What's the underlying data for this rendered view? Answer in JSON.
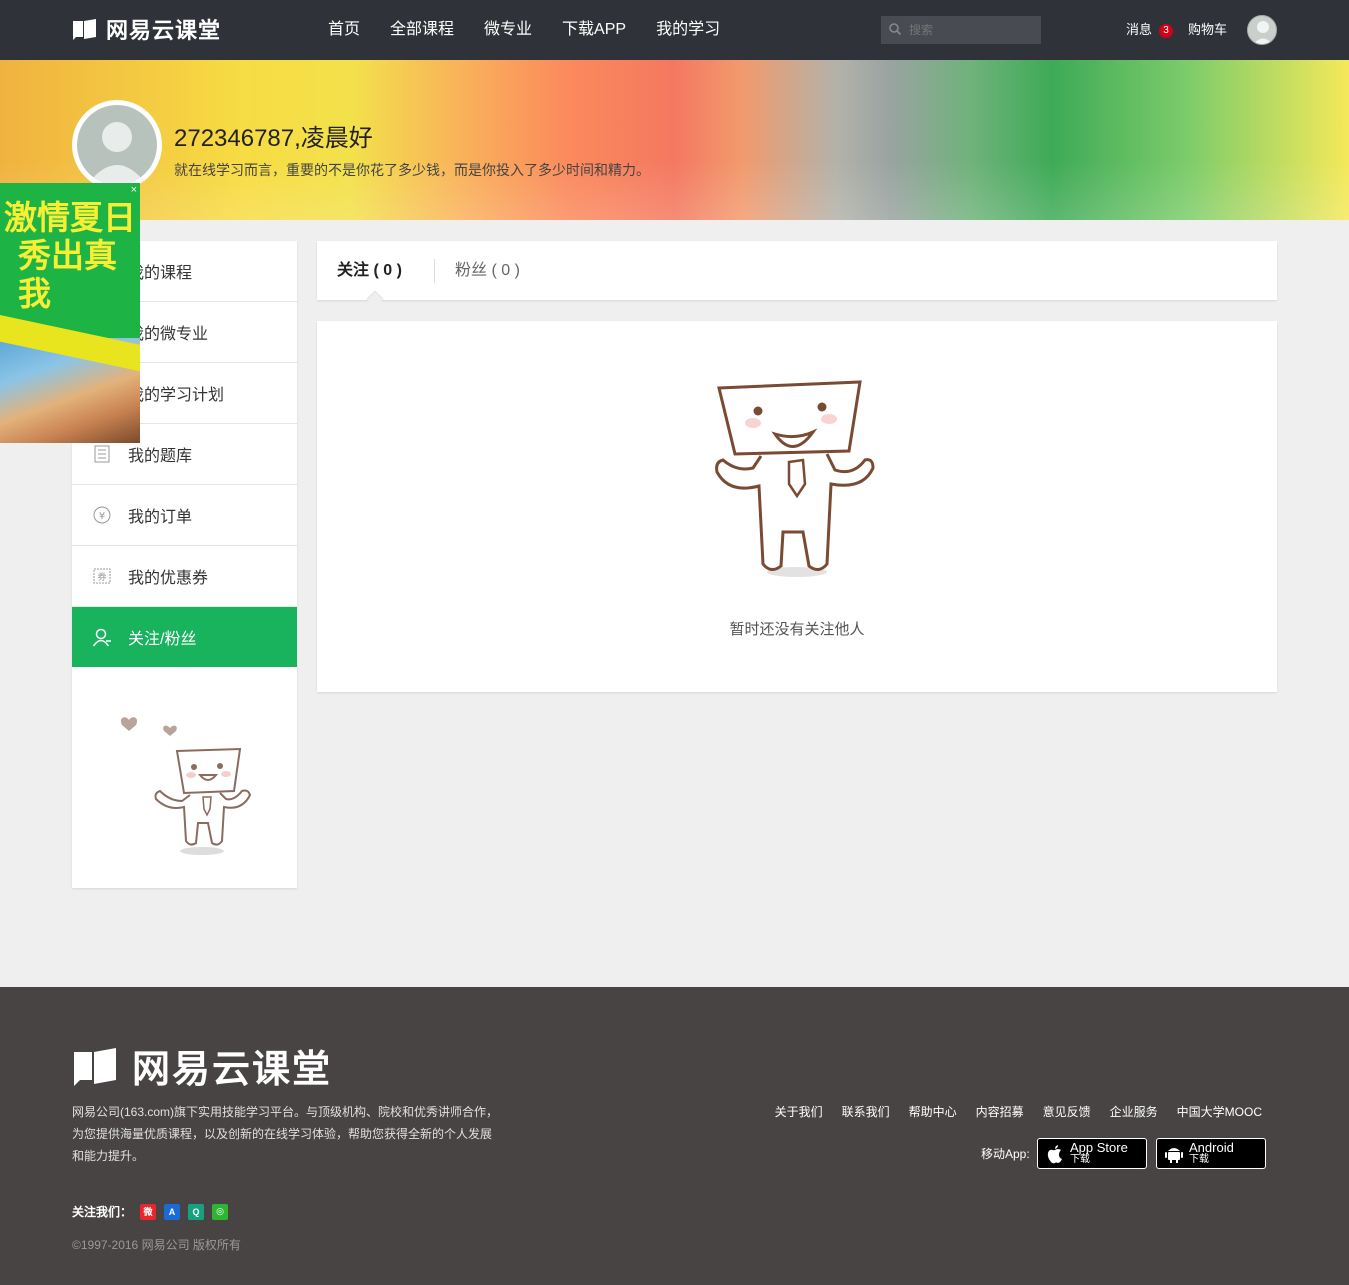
{
  "header": {
    "logo_text": "网易云课堂",
    "nav": [
      "首页",
      "全部课程",
      "微专业",
      "下载APP",
      "我的学习"
    ],
    "search_placeholder": "搜索",
    "messages_label": "消息",
    "messages_count": "3",
    "cart_label": "购物车"
  },
  "profile": {
    "name": "272346787,凌晨好",
    "motto": "就在线学习而言，重要的不是你花了多少钱，而是你投入了多少时间和精力。"
  },
  "ad": {
    "line1": "激情夏日",
    "line2": "秀出真我",
    "close": "×"
  },
  "sidebar": {
    "items": [
      {
        "label": "我的课程",
        "icon": "book-icon"
      },
      {
        "label": "我的微专业",
        "icon": "micro-major-icon"
      },
      {
        "label": "我的学习计划",
        "icon": "plan-icon"
      },
      {
        "label": "我的题库",
        "icon": "question-bank-icon"
      },
      {
        "label": "我的订单",
        "icon": "yen-icon"
      },
      {
        "label": "我的优惠券",
        "icon": "coupon-icon"
      },
      {
        "label": "关注/粉丝",
        "icon": "user-icon",
        "active": true
      }
    ]
  },
  "tabs": {
    "follow": "关注 ( 0 )",
    "fans": "粉丝 ( 0 )"
  },
  "empty_text": "暂时还没有关注他人",
  "footer": {
    "logo_text": "网易云课堂",
    "desc1": "网易公司(163.com)旗下实用技能学习平台。与顶级机构、院校和优秀讲师合作，",
    "desc2": "为您提供海量优质课程，以及创新的在线学习体验，帮助您获得全新的个人发展",
    "desc3": "和能力提升。",
    "follow_label": "关注我们：",
    "copyright": "©1997-2016 网易公司 版权所有",
    "links": [
      "关于我们",
      "联系我们",
      "帮助中心",
      "内容招募",
      "意见反馈",
      "企业服务",
      "中国大学MOOC"
    ],
    "app_label": "移动App:",
    "appstore_title": "App Store",
    "appstore_sub": "下载",
    "android_title": "Android",
    "android_sub": "下载"
  },
  "colors": {
    "topbar": "#2f3238",
    "accent_green": "#18b35c",
    "footer_bg": "#484444"
  }
}
